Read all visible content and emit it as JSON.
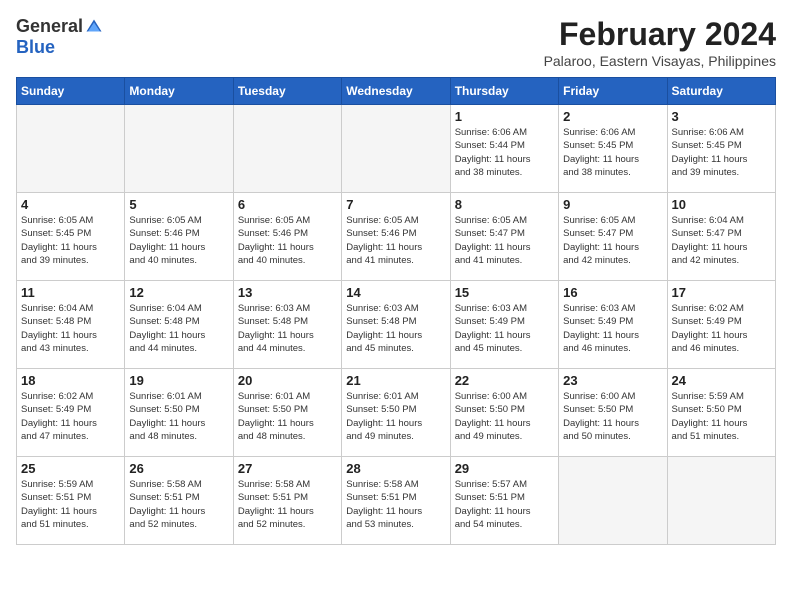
{
  "header": {
    "logo_general": "General",
    "logo_blue": "Blue",
    "month": "February 2024",
    "location": "Palaroo, Eastern Visayas, Philippines"
  },
  "columns": [
    "Sunday",
    "Monday",
    "Tuesday",
    "Wednesday",
    "Thursday",
    "Friday",
    "Saturday"
  ],
  "weeks": [
    [
      {
        "day": "",
        "info": ""
      },
      {
        "day": "",
        "info": ""
      },
      {
        "day": "",
        "info": ""
      },
      {
        "day": "",
        "info": ""
      },
      {
        "day": "1",
        "info": "Sunrise: 6:06 AM\nSunset: 5:44 PM\nDaylight: 11 hours\nand 38 minutes."
      },
      {
        "day": "2",
        "info": "Sunrise: 6:06 AM\nSunset: 5:45 PM\nDaylight: 11 hours\nand 38 minutes."
      },
      {
        "day": "3",
        "info": "Sunrise: 6:06 AM\nSunset: 5:45 PM\nDaylight: 11 hours\nand 39 minutes."
      }
    ],
    [
      {
        "day": "4",
        "info": "Sunrise: 6:05 AM\nSunset: 5:45 PM\nDaylight: 11 hours\nand 39 minutes."
      },
      {
        "day": "5",
        "info": "Sunrise: 6:05 AM\nSunset: 5:46 PM\nDaylight: 11 hours\nand 40 minutes."
      },
      {
        "day": "6",
        "info": "Sunrise: 6:05 AM\nSunset: 5:46 PM\nDaylight: 11 hours\nand 40 minutes."
      },
      {
        "day": "7",
        "info": "Sunrise: 6:05 AM\nSunset: 5:46 PM\nDaylight: 11 hours\nand 41 minutes."
      },
      {
        "day": "8",
        "info": "Sunrise: 6:05 AM\nSunset: 5:47 PM\nDaylight: 11 hours\nand 41 minutes."
      },
      {
        "day": "9",
        "info": "Sunrise: 6:05 AM\nSunset: 5:47 PM\nDaylight: 11 hours\nand 42 minutes."
      },
      {
        "day": "10",
        "info": "Sunrise: 6:04 AM\nSunset: 5:47 PM\nDaylight: 11 hours\nand 42 minutes."
      }
    ],
    [
      {
        "day": "11",
        "info": "Sunrise: 6:04 AM\nSunset: 5:48 PM\nDaylight: 11 hours\nand 43 minutes."
      },
      {
        "day": "12",
        "info": "Sunrise: 6:04 AM\nSunset: 5:48 PM\nDaylight: 11 hours\nand 44 minutes."
      },
      {
        "day": "13",
        "info": "Sunrise: 6:03 AM\nSunset: 5:48 PM\nDaylight: 11 hours\nand 44 minutes."
      },
      {
        "day": "14",
        "info": "Sunrise: 6:03 AM\nSunset: 5:48 PM\nDaylight: 11 hours\nand 45 minutes."
      },
      {
        "day": "15",
        "info": "Sunrise: 6:03 AM\nSunset: 5:49 PM\nDaylight: 11 hours\nand 45 minutes."
      },
      {
        "day": "16",
        "info": "Sunrise: 6:03 AM\nSunset: 5:49 PM\nDaylight: 11 hours\nand 46 minutes."
      },
      {
        "day": "17",
        "info": "Sunrise: 6:02 AM\nSunset: 5:49 PM\nDaylight: 11 hours\nand 46 minutes."
      }
    ],
    [
      {
        "day": "18",
        "info": "Sunrise: 6:02 AM\nSunset: 5:49 PM\nDaylight: 11 hours\nand 47 minutes."
      },
      {
        "day": "19",
        "info": "Sunrise: 6:01 AM\nSunset: 5:50 PM\nDaylight: 11 hours\nand 48 minutes."
      },
      {
        "day": "20",
        "info": "Sunrise: 6:01 AM\nSunset: 5:50 PM\nDaylight: 11 hours\nand 48 minutes."
      },
      {
        "day": "21",
        "info": "Sunrise: 6:01 AM\nSunset: 5:50 PM\nDaylight: 11 hours\nand 49 minutes."
      },
      {
        "day": "22",
        "info": "Sunrise: 6:00 AM\nSunset: 5:50 PM\nDaylight: 11 hours\nand 49 minutes."
      },
      {
        "day": "23",
        "info": "Sunrise: 6:00 AM\nSunset: 5:50 PM\nDaylight: 11 hours\nand 50 minutes."
      },
      {
        "day": "24",
        "info": "Sunrise: 5:59 AM\nSunset: 5:50 PM\nDaylight: 11 hours\nand 51 minutes."
      }
    ],
    [
      {
        "day": "25",
        "info": "Sunrise: 5:59 AM\nSunset: 5:51 PM\nDaylight: 11 hours\nand 51 minutes."
      },
      {
        "day": "26",
        "info": "Sunrise: 5:58 AM\nSunset: 5:51 PM\nDaylight: 11 hours\nand 52 minutes."
      },
      {
        "day": "27",
        "info": "Sunrise: 5:58 AM\nSunset: 5:51 PM\nDaylight: 11 hours\nand 52 minutes."
      },
      {
        "day": "28",
        "info": "Sunrise: 5:58 AM\nSunset: 5:51 PM\nDaylight: 11 hours\nand 53 minutes."
      },
      {
        "day": "29",
        "info": "Sunrise: 5:57 AM\nSunset: 5:51 PM\nDaylight: 11 hours\nand 54 minutes."
      },
      {
        "day": "",
        "info": ""
      },
      {
        "day": "",
        "info": ""
      }
    ]
  ]
}
